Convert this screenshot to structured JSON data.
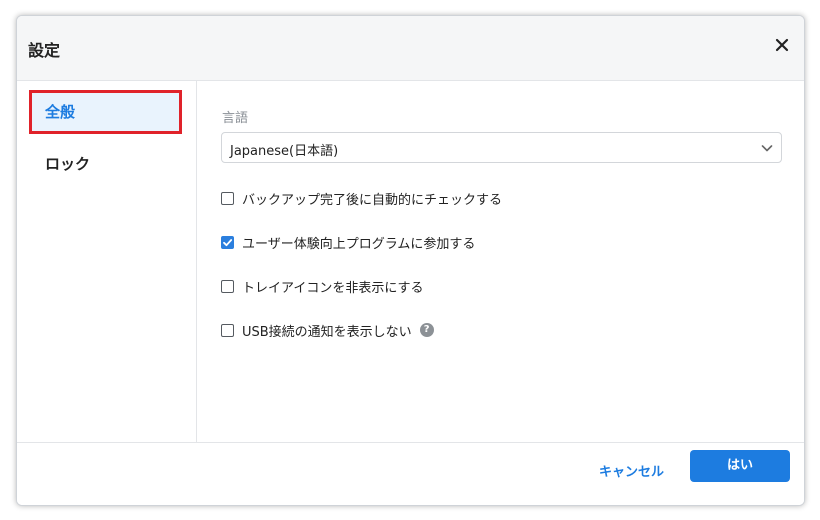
{
  "dialog": {
    "title": "設定",
    "close_icon": "close-icon"
  },
  "sidebar": {
    "items": [
      {
        "label": "全般",
        "active": true
      },
      {
        "label": "ロック",
        "active": false
      }
    ]
  },
  "general": {
    "language_label": "言語",
    "language_value": "Japanese(日本語)",
    "options": [
      {
        "label": "バックアップ完了後に自動的にチェックする",
        "checked": false
      },
      {
        "label": "ユーザー体験向上プログラムに参加する",
        "checked": true
      },
      {
        "label": "トレイアイコンを非表示にする",
        "checked": false
      },
      {
        "label": "USB接続の通知を表示しない",
        "checked": false,
        "help_icon": "question-circle-icon"
      }
    ]
  },
  "footer": {
    "cancel_label": "キャンセル",
    "ok_label": "はい"
  },
  "colors": {
    "accent": "#1d7ce0",
    "highlight_border": "#e0222a",
    "active_nav_bg": "#e9f3fd"
  }
}
